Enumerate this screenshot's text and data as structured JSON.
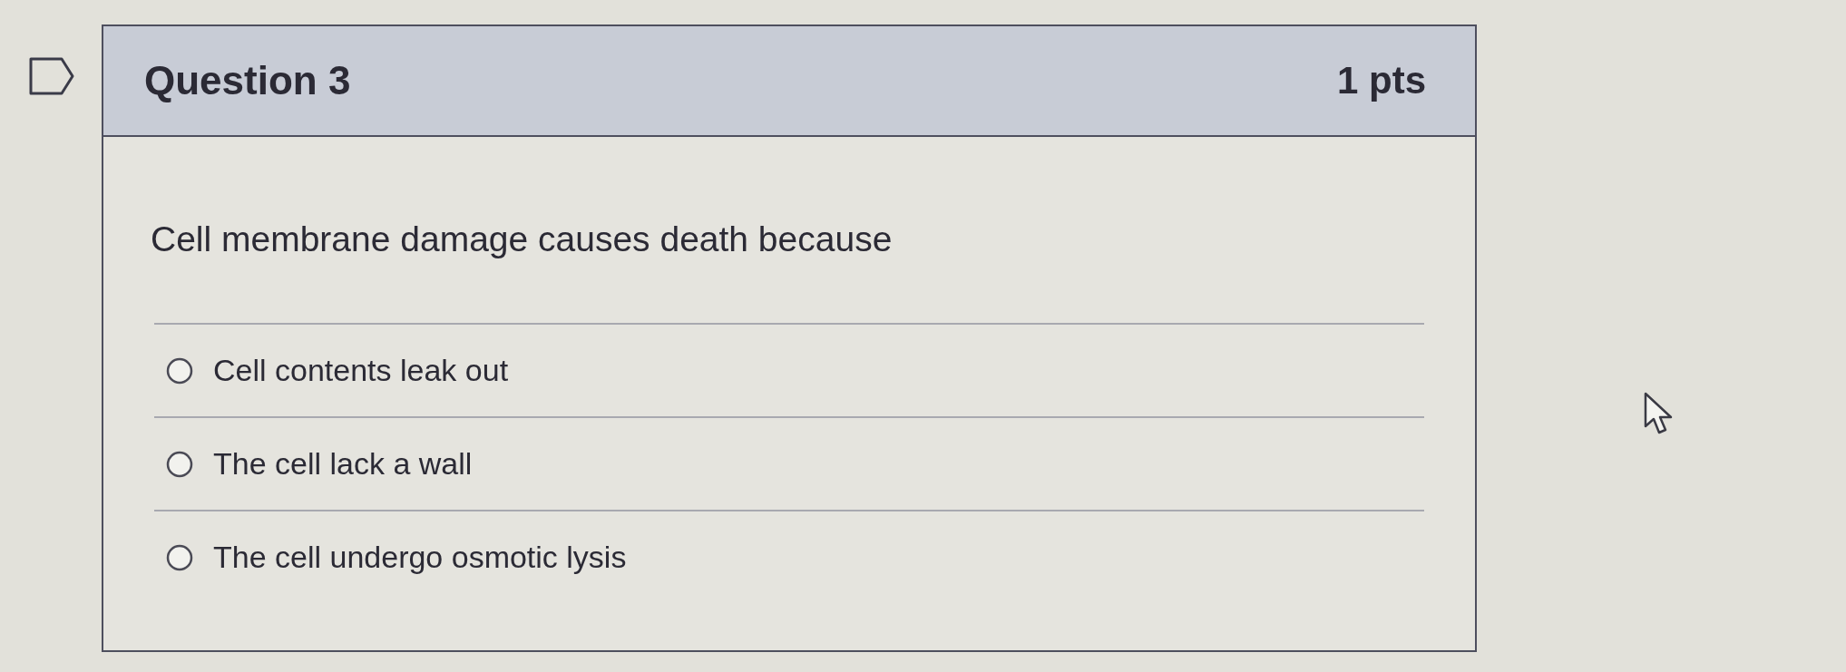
{
  "question": {
    "flagged": false,
    "title": "Question 3",
    "points": "1 pts",
    "prompt": "Cell membrane damage causes death because",
    "options": [
      {
        "label": "Cell contents leak out",
        "selected": false
      },
      {
        "label": "The cell lack a wall",
        "selected": false
      },
      {
        "label": "The cell undergo osmotic lysis",
        "selected": false
      }
    ]
  }
}
